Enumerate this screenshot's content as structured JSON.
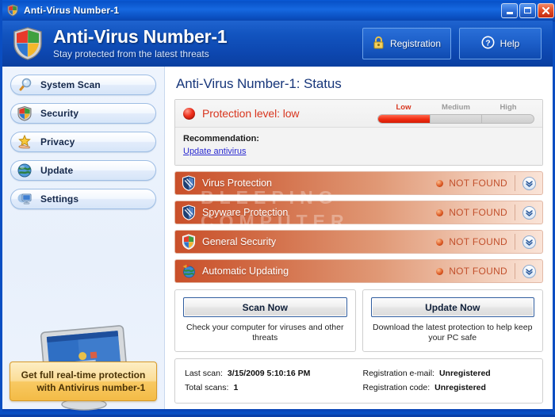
{
  "titlebar": {
    "title": "Anti-Virus Number-1",
    "icon": "shield-icon",
    "minimize": "–",
    "maximize": "□",
    "close": "✕"
  },
  "header": {
    "title": "Anti-Virus Number-1",
    "subtitle": "Stay protected from the latest threats",
    "buttons": [
      {
        "label": "Registration",
        "icon": "lock-icon"
      },
      {
        "label": "Help",
        "icon": "question-circle-icon"
      }
    ]
  },
  "sidebar": {
    "items": [
      {
        "label": "System Scan",
        "icon": "magnifier-icon"
      },
      {
        "label": "Security",
        "icon": "shield-icon"
      },
      {
        "label": "Privacy",
        "icon": "star-hand-icon"
      },
      {
        "label": "Update",
        "icon": "globe-icon"
      },
      {
        "label": "Settings",
        "icon": "monitor-gear-icon"
      }
    ],
    "illustration": "computer-monitor-illustration",
    "promo": {
      "line1": "Get full real-time protection",
      "line2": "with Antivirus number-1"
    }
  },
  "main": {
    "page_title": "Anti-Virus Number-1: Status",
    "protection": {
      "title": "Protection level: low",
      "indicator": "red-dot-icon",
      "gauge": {
        "labels": [
          "Low",
          "Medium",
          "High"
        ],
        "active_index": 0,
        "segments": [
          true,
          false,
          false
        ]
      },
      "recommendation_label": "Recommendation:",
      "recommendation_link": "Update antivirus"
    },
    "status_rows": [
      {
        "name": "Virus Protection",
        "icon": "blue-shield-icon",
        "status": "NOT FOUND",
        "expand": "chevron-double-down-icon"
      },
      {
        "name": "Spyware Protection",
        "icon": "blue-shield-icon",
        "status": "NOT FOUND",
        "expand": "chevron-double-down-icon"
      },
      {
        "name": "General Security",
        "icon": "color-shield-icon",
        "status": "NOT FOUND",
        "expand": "chevron-double-down-icon"
      },
      {
        "name": "Automatic Updating",
        "icon": "globe-update-icon",
        "status": "NOT FOUND",
        "expand": "chevron-double-down-icon"
      }
    ],
    "actions": [
      {
        "button": "Scan Now",
        "description": "Check your computer for viruses and other threats"
      },
      {
        "button": "Update Now",
        "description": "Download the latest protection to help keep your PC safe"
      }
    ],
    "info": {
      "left": [
        {
          "key": "Last scan:",
          "value": "3/15/2009 5:10:16 PM"
        },
        {
          "key": "Total scans:",
          "value": "1"
        }
      ],
      "right": [
        {
          "key": "Registration e-mail:",
          "value": "Unregistered"
        },
        {
          "key": "Registration code:",
          "value": "Unregistered"
        }
      ]
    },
    "watermark": "BLEEPING COMPUTER"
  },
  "colors": {
    "window_frame": "#0a46b8",
    "header_blue": "#0d47b0",
    "alert_red": "#d8361f",
    "status_row_red": "#c9502a",
    "promo_orange": "#f3bb46",
    "link_blue": "#2a2ad0"
  }
}
